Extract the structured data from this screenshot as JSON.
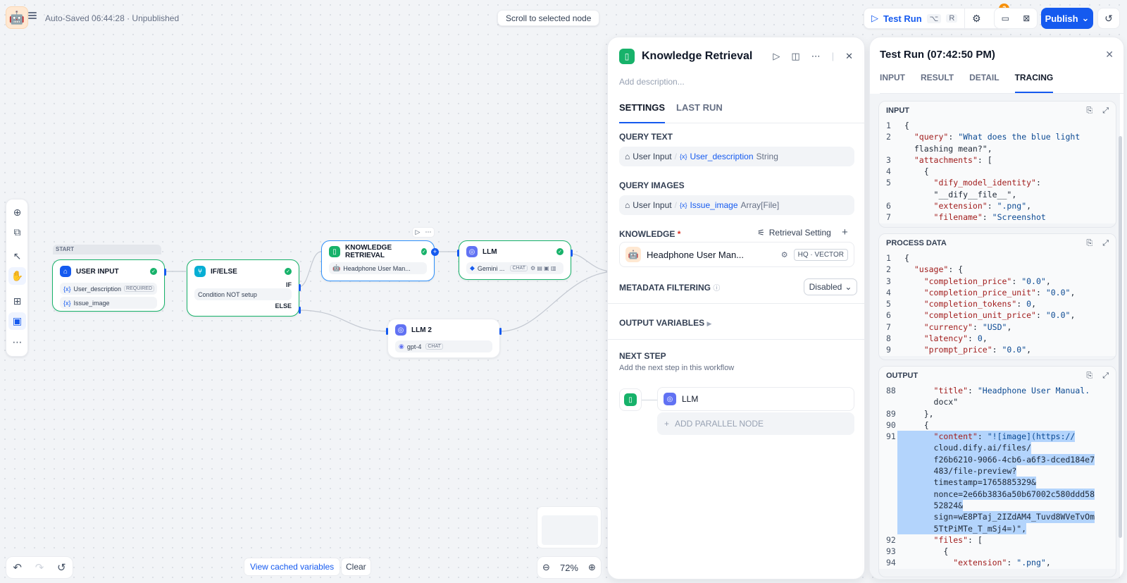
{
  "topbar": {
    "save_status": "Auto-Saved 06:44:28 · Unpublished",
    "scroll_button": "Scroll to selected node",
    "test_run_label": "Test Run",
    "test_run_shortcut_1": "⌥",
    "test_run_shortcut_2": "R",
    "checklist_badge": "3",
    "publish_label": "Publish"
  },
  "canvas": {
    "start_label": "START",
    "user_input": {
      "title": "USER INPUT",
      "var1": "User_description",
      "var1_tag": "REQUIRED",
      "var2": "Issue_image"
    },
    "ifelse": {
      "title": "IF/ELSE",
      "if_label": "IF",
      "condition": "Condition NOT setup",
      "else_label": "ELSE"
    },
    "knowledge": {
      "title": "KNOWLEDGE RETRIEVAL",
      "dataset": "Headphone User Man..."
    },
    "llm": {
      "title": "LLM",
      "model": "Gemini ...",
      "mode": "CHAT"
    },
    "llm2": {
      "title": "LLM 2",
      "model": "gpt-4",
      "mode": "CHAT"
    },
    "view_cached": "View cached variables",
    "clear": "Clear",
    "zoom": "72%"
  },
  "knowledge_panel": {
    "title": "Knowledge Retrieval",
    "description_placeholder": "Add description...",
    "tabs": [
      "SETTINGS",
      "LAST RUN"
    ],
    "query_text_label": "QUERY TEXT",
    "query_text": {
      "node": "User Input",
      "var": "User_description",
      "type": "String"
    },
    "query_images_label": "QUERY IMAGES",
    "query_images": {
      "node": "User Input",
      "var": "Issue_image",
      "type": "Array[File]"
    },
    "knowledge_label": "KNOWLEDGE",
    "required_mark": "*",
    "retrieval_setting": "Retrieval Setting",
    "dataset_name": "Headphone User Man...",
    "dataset_tag": "HQ · VECTOR",
    "metadata_label": "METADATA FILTERING",
    "metadata_value": "Disabled",
    "output_vars_label": "OUTPUT VARIABLES",
    "next_step_label": "NEXT STEP",
    "next_step_desc": "Add the next step in this workflow",
    "next_node": "LLM",
    "add_parallel": "ADD PARALLEL NODE"
  },
  "test_panel": {
    "title": "Test Run (07:42:50 PM)",
    "tabs": [
      "INPUT",
      "RESULT",
      "DETAIL",
      "TRACING"
    ],
    "active_tab": "TRACING",
    "input_label": "INPUT",
    "process_label": "PROCESS DATA",
    "output_label": "OUTPUT",
    "input_lines": [
      {
        "n": "1",
        "t": "{"
      },
      {
        "n": "2",
        "t": "  \"query\": \"What does the blue light"
      },
      {
        "n": "",
        "t": "  flashing mean?\","
      },
      {
        "n": "3",
        "t": "  \"attachments\": ["
      },
      {
        "n": "4",
        "t": "    {"
      },
      {
        "n": "5",
        "t": "      \"dify_model_identity\":"
      },
      {
        "n": "",
        "t": "      \"__dify__file__\","
      },
      {
        "n": "6",
        "t": "      \"extension\": \".png\","
      },
      {
        "n": "7",
        "t": "      \"filename\": \"Screenshot"
      }
    ],
    "process_lines": [
      {
        "n": "1",
        "t": "{"
      },
      {
        "n": "2",
        "t": "  \"usage\": {"
      },
      {
        "n": "3",
        "t": "    \"completion_price\": \"0.0\","
      },
      {
        "n": "4",
        "t": "    \"completion_price_unit\": \"0.0\","
      },
      {
        "n": "5",
        "t": "    \"completion_tokens\": 0,"
      },
      {
        "n": "6",
        "t": "    \"completion_unit_price\": \"0.0\","
      },
      {
        "n": "7",
        "t": "    \"currency\": \"USD\","
      },
      {
        "n": "8",
        "t": "    \"latency\": 0,"
      },
      {
        "n": "9",
        "t": "    \"prompt_price\": \"0.0\","
      }
    ],
    "output_lines": [
      {
        "n": "88",
        "t": "      \"title\": \"Headphone User Manual."
      },
      {
        "n": "",
        "t": "      docx\""
      },
      {
        "n": "89",
        "t": "    },"
      },
      {
        "n": "90",
        "t": "    {"
      },
      {
        "n": "91",
        "t": "      \"content\": \"![image](https://",
        "hl": true
      },
      {
        "n": "",
        "t": "      cloud.dify.ai/files/",
        "hl": true
      },
      {
        "n": "",
        "t": "      f26b6210-9066-4cb6-a6f3-dced184e7",
        "hl": true
      },
      {
        "n": "",
        "t": "      483/file-preview?",
        "hl": true
      },
      {
        "n": "",
        "t": "      timestamp=1765885329&",
        "hl": true
      },
      {
        "n": "",
        "t": "      nonce=2e66b3836a50b67002c580ddd58",
        "hl": true
      },
      {
        "n": "",
        "t": "      52824&",
        "hl": true
      },
      {
        "n": "",
        "t": "      sign=wE8PTaj_2IZdAM4_Tuvd8WVeTvOm",
        "hl": true
      },
      {
        "n": "",
        "t": "      5TtPiMTe_T_mSj4=)\",",
        "hl": true
      },
      {
        "n": "92",
        "t": "      \"files\": ["
      },
      {
        "n": "93",
        "t": "        {"
      },
      {
        "n": "94",
        "t": "          \"extension\": \".png\","
      }
    ]
  },
  "colors": {
    "accent": "#155aef",
    "success": "#17b26a",
    "warning": "#f79009"
  }
}
